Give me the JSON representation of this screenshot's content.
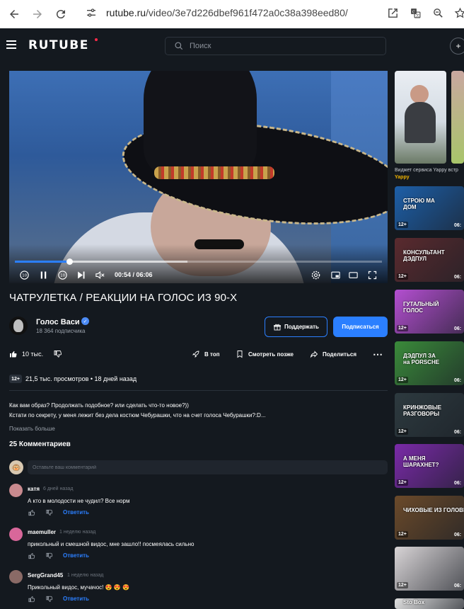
{
  "browser": {
    "url_host": "rutube.ru",
    "url_path": "/video/3e7d226dbef961f472a0c38a398eed80/"
  },
  "header": {
    "logo": "RUTUBE",
    "search_placeholder": "Поиск"
  },
  "player": {
    "current_time": "00:54",
    "duration": "06:06",
    "time_display": "00:54 / 06:06",
    "progress_fraction": 0.148,
    "buffered_fraction": 0.47,
    "skip_seconds": "10"
  },
  "video": {
    "title": "ЧАТРУЛЕТКА / РЕАКЦИИ НА ГОЛОС ИЗ 90-Х",
    "channel_name": "Голос Васи",
    "subscribers": "18 364 подписчика",
    "support_label": "Поддержать",
    "subscribe_label": "Подписаться",
    "likes": "10 тыс.",
    "top_label": "В топ",
    "watch_later_label": "Смотреть позже",
    "share_label": "Поделиться",
    "age_rating": "12+",
    "stats": "21,5 тыс. просмотров  •  18 дней назад",
    "description_line1": "Как вам образ? Продолжать подобное? или сделать что-то новое?))",
    "description_line2": "Кстати по секрету, у меня лежит без дела костюм Чебурашки, что на счет голоса Чебурашки?:D...",
    "show_more": "Показать больше"
  },
  "comments": {
    "title": "25 Комментариев",
    "input_placeholder": "Оставьте ваш комментарий",
    "reply_label": "Ответить",
    "items": [
      {
        "author": "катя",
        "time": "6 дней назад",
        "text": "А кто в молодости не чудил? Все норм",
        "avatar_color": "#c98a8f"
      },
      {
        "author": "maemuller",
        "time": "1 неделю назад",
        "text": "прикольный и смешной видос, мне зашло!! посмеялась сильно",
        "avatar_color": "#d8679a"
      },
      {
        "author": "SergGrand45",
        "time": "1 неделю назад",
        "text": "Прикольный видос, мучачос! 😍 😍 😍",
        "avatar_color": "#8a6a66"
      }
    ]
  },
  "sidebar": {
    "promo_title": "Виджет сервиса Yappy встр",
    "promo_sub": "Yappy",
    "videos": [
      {
        "age": "12+",
        "duration": "06:",
        "caption": "СТРОЮ МА\nДОМ",
        "bg": "#1d5fa8"
      },
      {
        "age": "12+",
        "duration": "06:",
        "caption": "КОНСУЛЬТАНТ\nДЭДПУЛ",
        "bg": "#5a2a2e"
      },
      {
        "age": "12+",
        "duration": "06:",
        "caption": "ГУТАЛЬНЫЙ\nГОЛОС",
        "bg": "#b44fd1"
      },
      {
        "age": "12+",
        "duration": "06:",
        "caption": "ДЭДПУЛ ЗА\nна PORSCHE",
        "bg": "#3a8a3a"
      },
      {
        "age": "12+",
        "duration": "06:",
        "caption": "КРИНЖОВЫЕ\nРАЗГОВОРЫ",
        "bg": "#2d3a3f"
      },
      {
        "age": "12+",
        "duration": "06:",
        "caption": "А МЕНЯ\nШАРАХНЕТ?",
        "bg": "#7a2aa8"
      },
      {
        "age": "12+",
        "duration": "06:",
        "caption": "ЧИХОВЫЕ ИЗ ГОЛОВЫ",
        "bg": "#6b4a2a"
      },
      {
        "age": "12+",
        "duration": "06:",
        "caption": "",
        "bg": "#d8d4d6"
      },
      {
        "age": "",
        "duration": "",
        "caption": "Sto Box",
        "bg": "#e0e0e0"
      }
    ]
  }
}
